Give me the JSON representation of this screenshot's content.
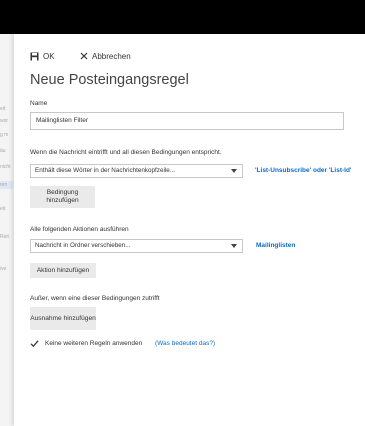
{
  "background": {
    "fragments": [
      "eit",
      "wor",
      "g m",
      "äu",
      "nicht",
      "ren",
      "",
      "eit",
      "",
      "Reit",
      "",
      "ive"
    ]
  },
  "toolbar": {
    "ok_label": "OK",
    "cancel_label": "Abbrechen"
  },
  "dialog": {
    "title": "Neue Posteingangsregel"
  },
  "name_field": {
    "label": "Name",
    "value": "Mailinglisten Filter"
  },
  "conditions": {
    "label": "Wenn die Nachricht eintrifft und all diesen Bedingungen entspricht.",
    "dropdown_value": "Enthält diese Wörter in der Nachrichtenkopfzeile...",
    "value_link": "'List-Unsubscribe' oder 'List-Id'",
    "add_button": "Bedingung hinzufügen"
  },
  "actions": {
    "label": "Alle folgenden Aktionen ausführen",
    "dropdown_value": "Nachricht in Ordner verschieben...",
    "value_link": "Mailinglisten",
    "add_button": "Aktion hinzufügen"
  },
  "exceptions": {
    "label": "Außer, wenn eine dieser Bedingungen zutrifft",
    "add_button": "Ausnahme hinzufügen"
  },
  "stop_rules": {
    "checked": true,
    "label": "Keine weiteren Regeln anwenden",
    "help_link": "(Was bedeutet das?)"
  }
}
